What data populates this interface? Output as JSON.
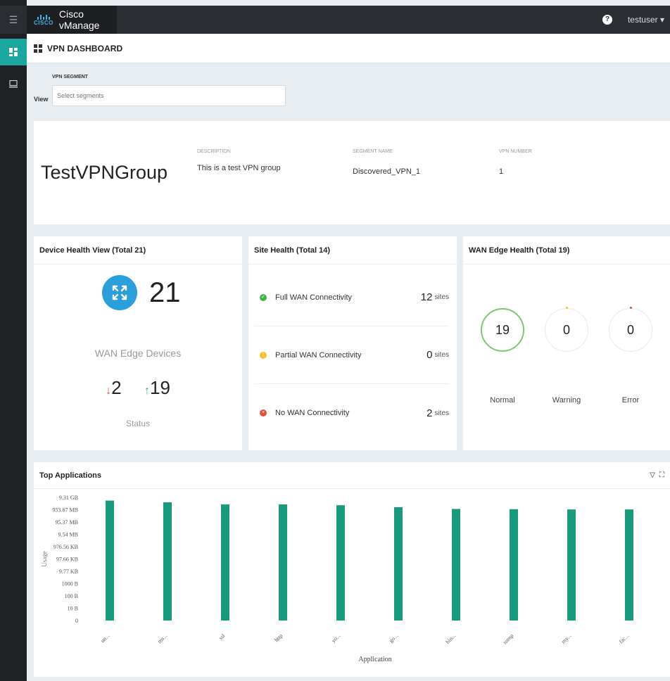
{
  "app": {
    "brand_word": "CISCO",
    "title": "Cisco vManage",
    "help_icon": "?",
    "user": "testuser ▾",
    "menu_icon": "hamburger-icon"
  },
  "nav": {
    "items": [
      {
        "icon": "dashboard-icon",
        "active": true
      },
      {
        "icon": "monitor-icon",
        "active": false
      }
    ]
  },
  "page": {
    "title": "VPN DASHBOARD"
  },
  "segment": {
    "label": "VPN SEGMENT",
    "view_label": "View",
    "placeholder": "Select segments"
  },
  "vpn": {
    "name": "TestVPNGroup",
    "description_label": "DESCRIPTION",
    "description": "This is a test VPN group",
    "segment_name_label": "SEGMENT NAME",
    "segment_name": "Discovered_VPN_1",
    "vpn_number_label": "VPN NUMBER",
    "vpn_number": "1"
  },
  "device_health": {
    "title": "Device Health View (Total 21)",
    "count": "21",
    "subtitle": "WAN Edge Devices",
    "down_arrow": "↓",
    "down": "2",
    "up_arrow": "↑",
    "up": "19",
    "status_label": "Status"
  },
  "site_health": {
    "title": "Site Health (Total 14)",
    "rows": [
      {
        "label": "Full WAN Connectivity",
        "value": "12",
        "unit": "sites",
        "status": "green",
        "glyph": "✓"
      },
      {
        "label": "Partial WAN Connectivity",
        "value": "0",
        "unit": "sites",
        "status": "yellow",
        "glyph": "!"
      },
      {
        "label": "No WAN Connectivity",
        "value": "2",
        "unit": "sites",
        "status": "red",
        "glyph": "×"
      }
    ]
  },
  "wan_edge_health": {
    "title": "WAN Edge Health (Total 19)",
    "items": [
      {
        "label": "Normal",
        "value": "19"
      },
      {
        "label": "Warning",
        "value": "0"
      },
      {
        "label": "Error",
        "value": "0"
      }
    ]
  },
  "top_applications": {
    "title": "Top Applications",
    "tools": [
      "▽",
      "⛶"
    ]
  },
  "chart_data": {
    "type": "bar",
    "title": "Top Applications",
    "xlabel": "Application",
    "ylabel": "Usage",
    "y_scale": "log",
    "y_ticks": [
      "9.31 GB",
      "953.67 MB",
      "95.37 MB",
      "9.54 MB",
      "976.56 KB",
      "97.66 KB",
      "9.77 KB",
      "1000 B",
      "100 B",
      "10 B",
      "0"
    ],
    "categories": [
      "un...",
      "ms...",
      "ssl",
      "http",
      "yo...",
      "go...",
      "bin...",
      "snmp",
      "my...",
      "fac..."
    ],
    "values_bytes": [
      5500000000,
      4000000000,
      2700000000,
      2700000000,
      2300000000,
      1600000000,
      1150000000,
      1100000000,
      1050000000,
      1050000000
    ],
    "color": "#1a9a7c",
    "grid": false,
    "legend": "none"
  }
}
